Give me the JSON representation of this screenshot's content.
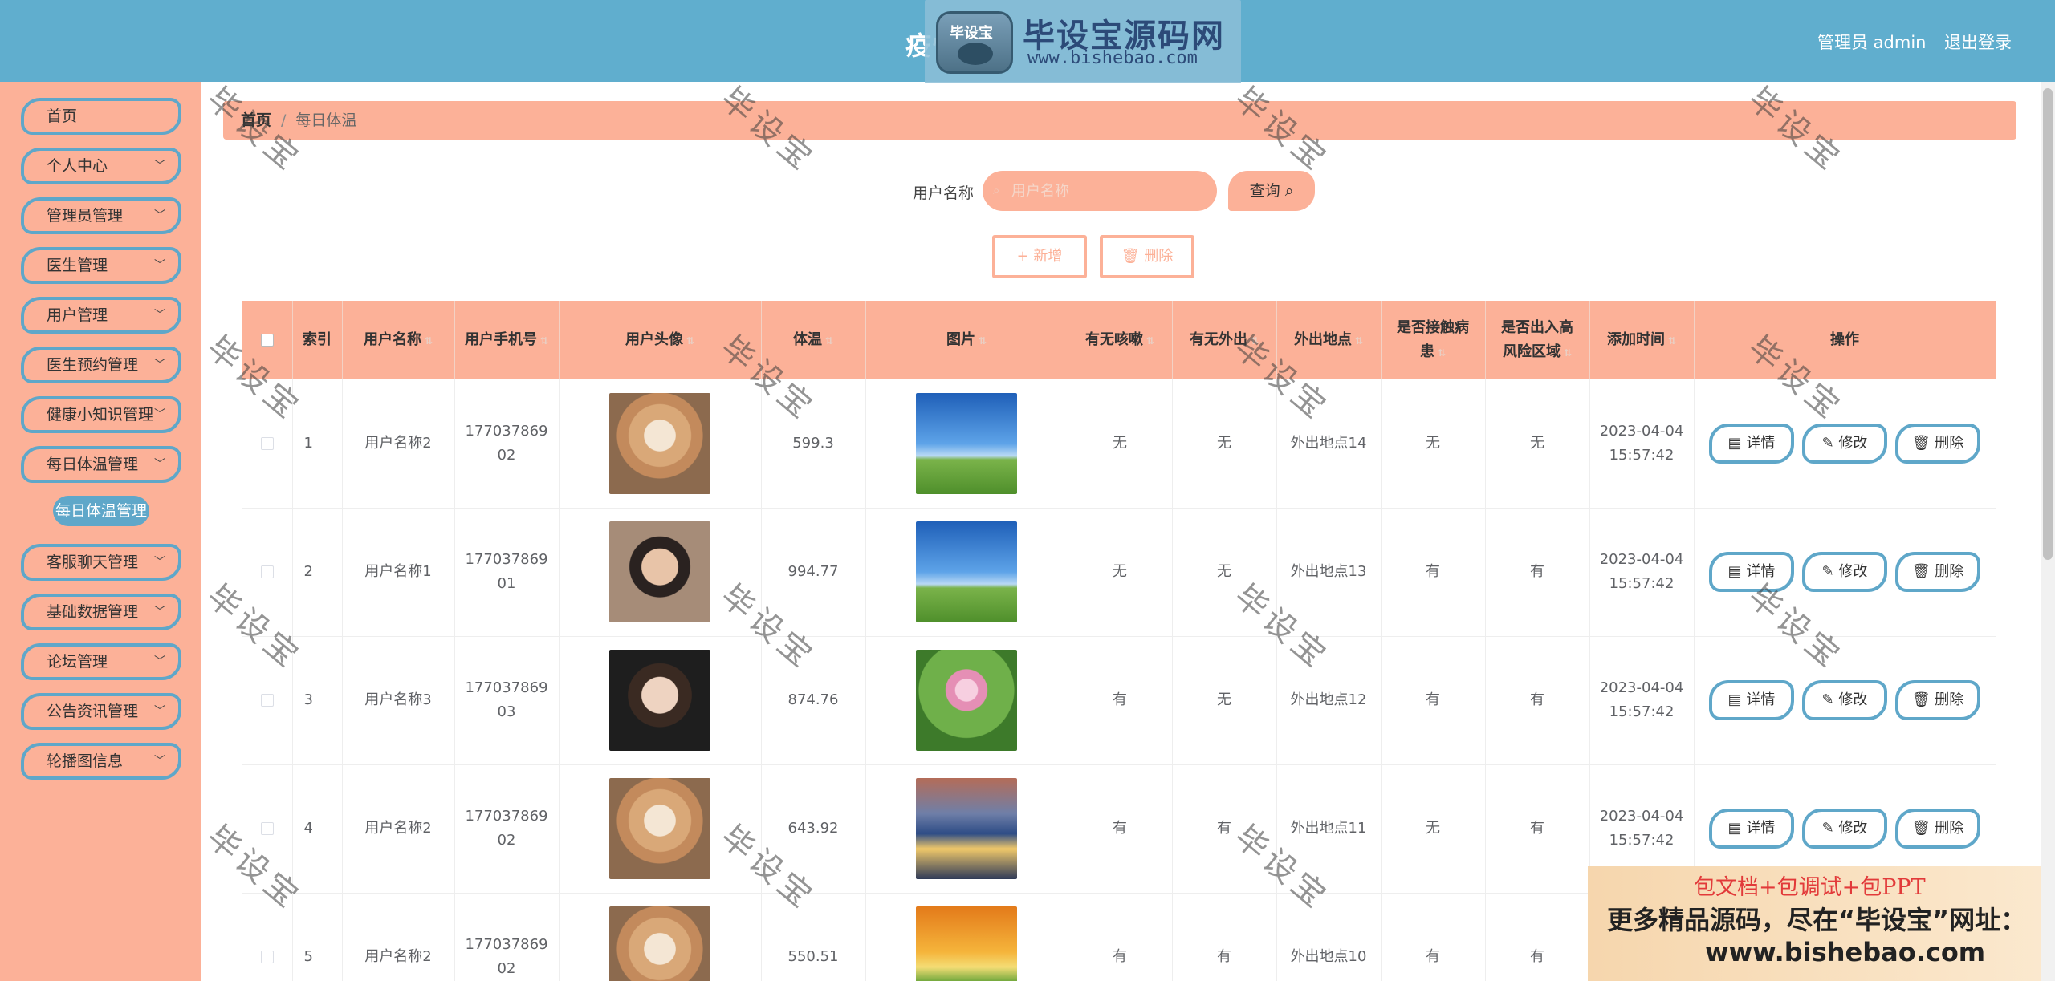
{
  "header": {
    "title": "疫情",
    "admin_label": "管理员 admin",
    "logout_label": "退出登录",
    "logo_badge_text": "毕设宝",
    "logo_text": "毕设宝源码网",
    "logo_url": "www.bishebao.com"
  },
  "sidebar": {
    "items": [
      {
        "label": "首页",
        "has_chevron": false
      },
      {
        "label": "个人中心",
        "has_chevron": true
      },
      {
        "label": "管理员管理",
        "has_chevron": true
      },
      {
        "label": "医生管理",
        "has_chevron": true
      },
      {
        "label": "用户管理",
        "has_chevron": true
      },
      {
        "label": "医生预约管理",
        "has_chevron": true
      },
      {
        "label": "健康小知识管理",
        "has_chevron": true
      },
      {
        "label": "每日体温管理",
        "has_chevron": true
      },
      {
        "label": "客服聊天管理",
        "has_chevron": true
      },
      {
        "label": "基础数据管理",
        "has_chevron": true
      },
      {
        "label": "论坛管理",
        "has_chevron": true
      },
      {
        "label": "公告资讯管理",
        "has_chevron": true
      },
      {
        "label": "轮播图信息",
        "has_chevron": true
      }
    ],
    "active_sub": "每日体温管理"
  },
  "breadcrumb": {
    "home": "首页",
    "separator": "/",
    "current": "每日体温"
  },
  "search": {
    "label": "用户名称",
    "placeholder": "用户名称",
    "button": "查询"
  },
  "actions": {
    "add": "+ 新增",
    "delete": "删除"
  },
  "table": {
    "columns": [
      "索引",
      "用户名称",
      "用户手机号",
      "用户头像",
      "体温",
      "图片",
      "有无咳嗽",
      "有无外出",
      "外出地点",
      "是否接触病患",
      "是否出入高风险区域",
      "添加时间",
      "操作"
    ],
    "row_buttons": {
      "detail": "详情",
      "edit": "修改",
      "delete": "删除"
    },
    "rows": [
      {
        "index": "1",
        "name": "用户名称2",
        "phone": "17703786902",
        "avatar": "dog",
        "temp": "599.3",
        "image": "sky",
        "cough": "无",
        "out": "无",
        "place": "外出地点14",
        "contact": "无",
        "risk": "无",
        "date": "2023-04-04",
        "time": "15:57:42"
      },
      {
        "index": "2",
        "name": "用户名称1",
        "phone": "17703786901",
        "avatar": "man",
        "temp": "994.77",
        "image": "sky",
        "cough": "无",
        "out": "无",
        "place": "外出地点13",
        "contact": "有",
        "risk": "有",
        "date": "2023-04-04",
        "time": "15:57:42"
      },
      {
        "index": "3",
        "name": "用户名称3",
        "phone": "17703786903",
        "avatar": "woman",
        "temp": "874.76",
        "image": "lotus",
        "cough": "有",
        "out": "无",
        "place": "外出地点12",
        "contact": "有",
        "risk": "有",
        "date": "2023-04-04",
        "time": "15:57:42"
      },
      {
        "index": "4",
        "name": "用户名称2",
        "phone": "17703786902",
        "avatar": "dog",
        "temp": "643.92",
        "image": "city",
        "cough": "有",
        "out": "有",
        "place": "外出地点11",
        "contact": "无",
        "risk": "有",
        "date": "2023-04-04",
        "time": "15:57:42"
      },
      {
        "index": "5",
        "name": "用户名称2",
        "phone": "17703786902",
        "avatar": "dog",
        "temp": "550.51",
        "image": "flowers",
        "cough": "有",
        "out": "有",
        "place": "外出地点10",
        "contact": "有",
        "risk": "有",
        "date": "",
        "time": ""
      }
    ]
  },
  "watermark": "毕设宝",
  "ad": {
    "line1": "包文档+包调试+包PPT",
    "line2": "更多精品源码，尽在“毕设宝”网址：",
    "line3": "www.bishebao.com"
  },
  "colors": {
    "header": "#60aece",
    "accent": "#fcb198",
    "border_blue": "#5fa7c9"
  }
}
